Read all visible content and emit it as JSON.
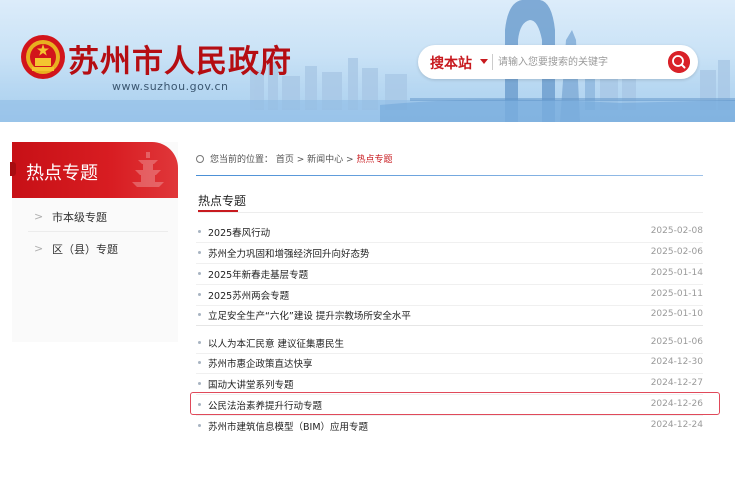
{
  "header": {
    "site_title": "苏州市人民政府",
    "site_url": "www.suzhou.gov.cn",
    "search": {
      "scope_label": "搜本站",
      "placeholder": "请输入您要搜索的关键字"
    },
    "colors": {
      "brand_red": "#c81a1f",
      "sky": "#c9e2f6"
    }
  },
  "sidebar": {
    "title": "热点专题",
    "items": [
      {
        "chevron": ">",
        "label": "市本级专题"
      },
      {
        "chevron": ">",
        "label": "区（县）专题"
      }
    ]
  },
  "breadcrumb": {
    "prefix": "您当前的位置：",
    "home": "首页",
    "sep1": " > ",
    "news_center": "新闻中心",
    "sep2": " > ",
    "current": "热点专题"
  },
  "section": {
    "title": "热点专题"
  },
  "news": [
    {
      "title": "2025春风行动",
      "date": "2025-02-08"
    },
    {
      "title": "苏州全力巩固和增强经济回升向好态势",
      "date": "2025-02-06"
    },
    {
      "title": "2025年新春走基层专题",
      "date": "2025-01-14"
    },
    {
      "title": "2025苏州两会专题",
      "date": "2025-01-11"
    },
    {
      "title": "立足安全生产“六化”建设 提升宗教场所安全水平",
      "date": "2025-01-10"
    },
    {
      "title": "以人为本汇民意 建议征集惠民生",
      "date": "2025-01-06"
    },
    {
      "title": "苏州市惠企政策直达快享",
      "date": "2024-12-30"
    },
    {
      "title": "国动大讲堂系列专题",
      "date": "2024-12-27"
    },
    {
      "title": "公民法治素养提升行动专题",
      "date": "2024-12-26",
      "highlighted": true
    },
    {
      "title": "苏州市建筑信息模型（BIM）应用专题",
      "date": "2024-12-24"
    }
  ]
}
